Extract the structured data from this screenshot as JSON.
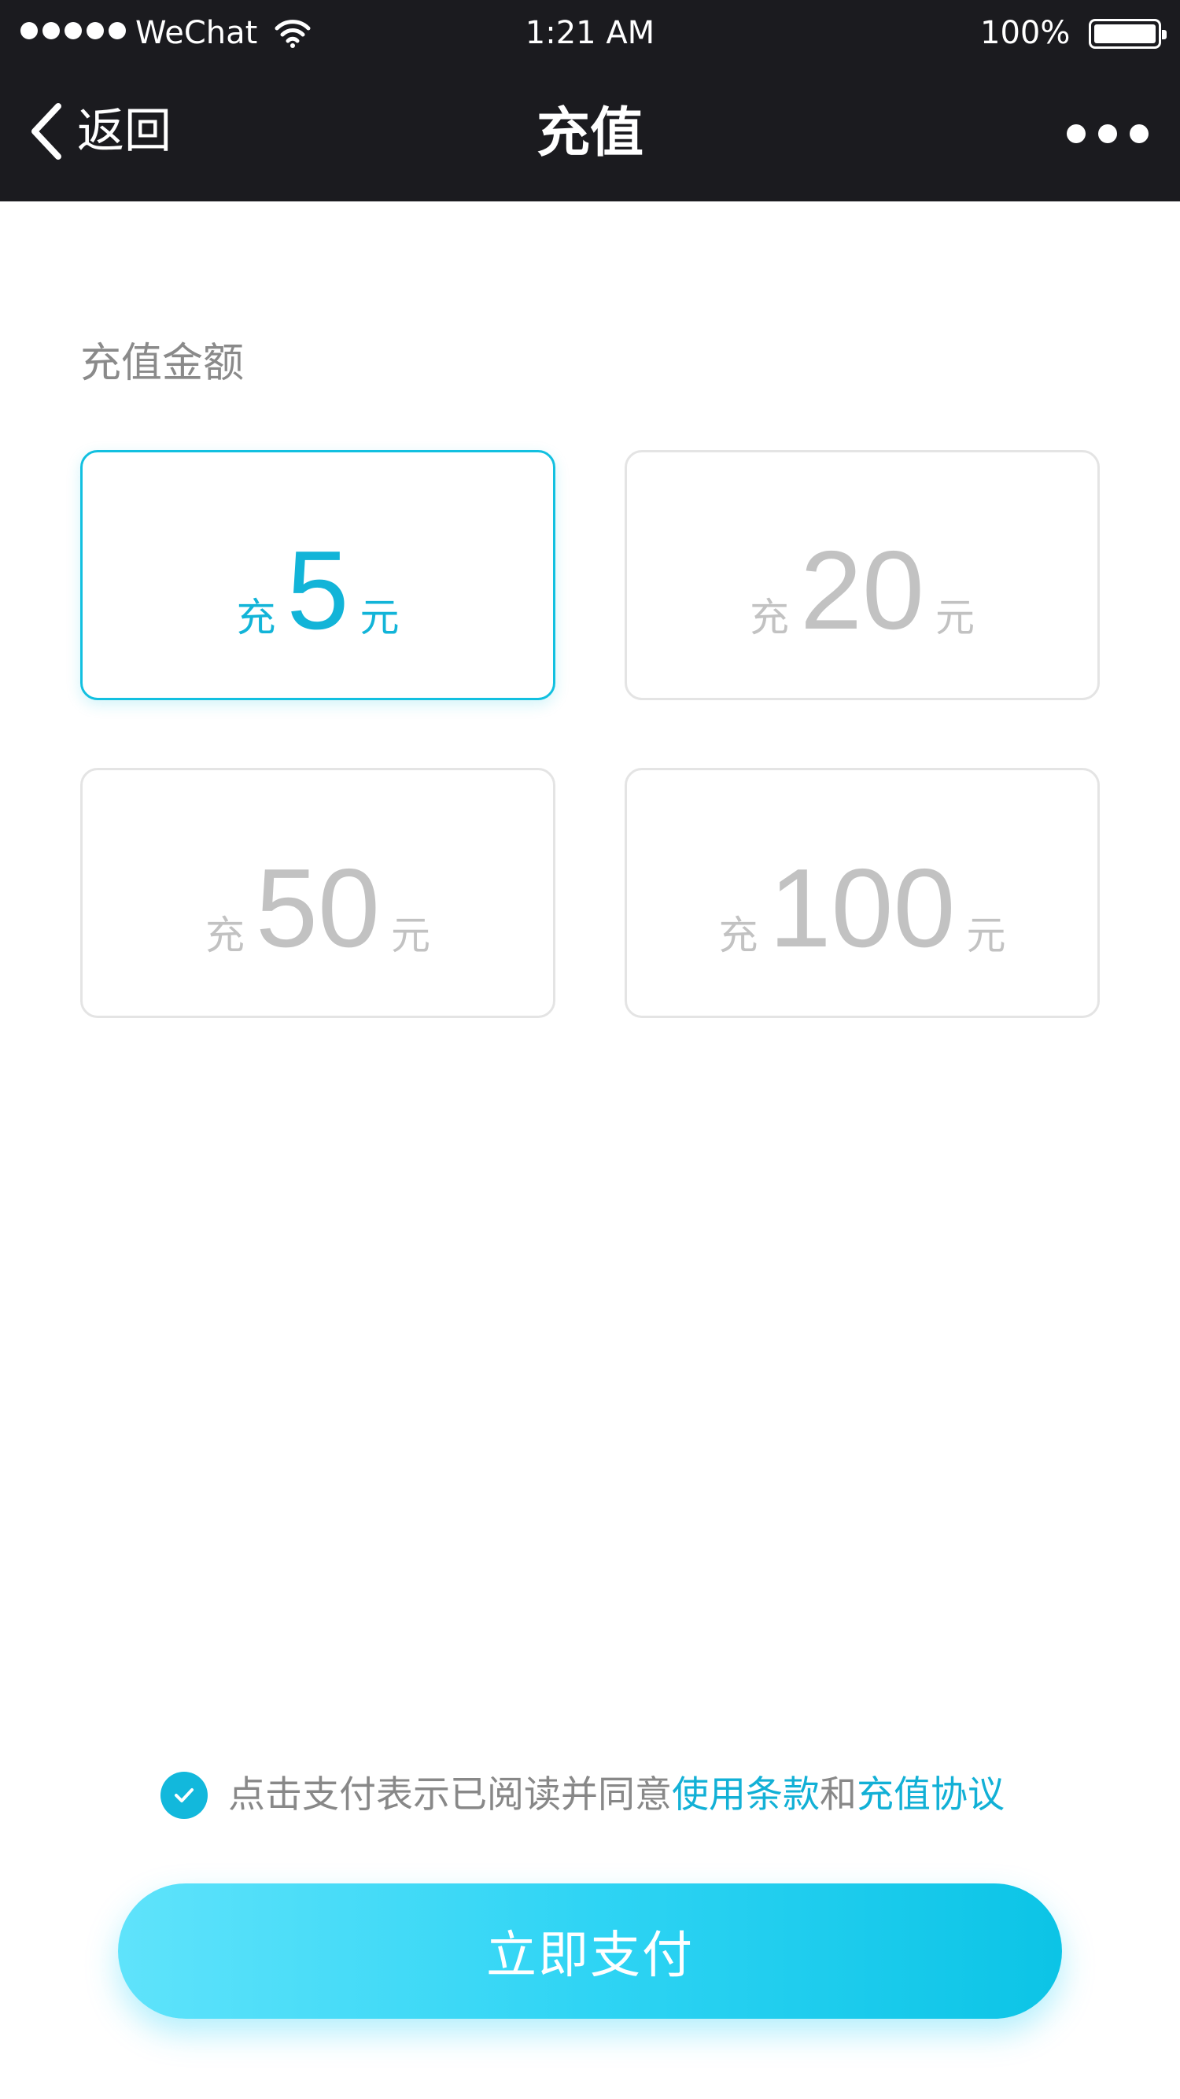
{
  "status_bar": {
    "carrier": "WeChat",
    "time": "1:21 AM",
    "battery_percent": "100%",
    "battery_level": 1.0
  },
  "nav": {
    "back_label": "返回",
    "title": "充值"
  },
  "recharge": {
    "section_label": "充值金额",
    "options": [
      {
        "prefix": "充",
        "amount": "5",
        "unit": "元",
        "selected": true
      },
      {
        "prefix": "充",
        "amount": "20",
        "unit": "元",
        "selected": false
      },
      {
        "prefix": "充",
        "amount": "50",
        "unit": "元",
        "selected": false
      },
      {
        "prefix": "充",
        "amount": "100",
        "unit": "元",
        "selected": false
      }
    ]
  },
  "agreement": {
    "checked": true,
    "text_before": "点击支付表示已阅读并同意",
    "terms_link": "使用条款",
    "conjunction": "和",
    "agreement_link": "充值协议"
  },
  "pay_button": {
    "label": "立即支付"
  },
  "colors": {
    "accent": "#12b8dc",
    "bar_background": "#1b1b1f",
    "unselected_text": "#c2c2c2"
  }
}
